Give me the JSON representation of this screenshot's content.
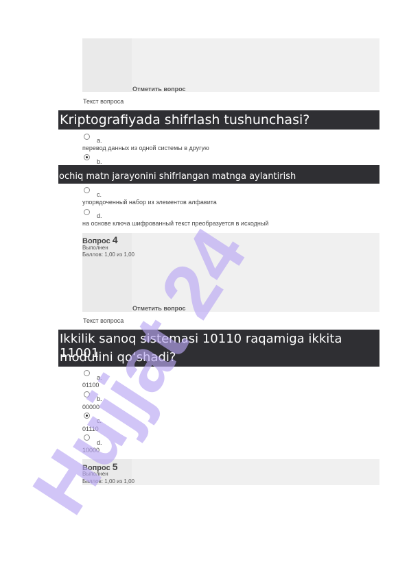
{
  "flag_label": "Отметить вопрос",
  "question_text_label": "Текст вопроса",
  "q3": {
    "text": "Kriptografiyada shifrlash tushunchasi?",
    "options": [
      {
        "letter": "a.",
        "text": "перевод данных из одной системы в другую",
        "checked": false
      },
      {
        "letter": "b.",
        "text": "ochiq matn jarayonini shifrlangan matnga aylantirish",
        "checked": true
      },
      {
        "letter": "c.",
        "text": "упорядоченный набор из элементов алфавита",
        "checked": false
      },
      {
        "letter": "d.",
        "text": "на основе ключа шифрованный текст преобразуется в исходный",
        "checked": false
      }
    ]
  },
  "q4": {
    "label": "Вопрос",
    "number": "4",
    "status": "Выполнен",
    "points": "Баллов: 1,00 из 1,00",
    "text_line1": "Ikkilik sanoq sistemasi 10110 raqamiga ikkita 11001",
    "text_line2": "modulini qo‘shadi?",
    "options": [
      {
        "letter": "a.",
        "text": "01100",
        "checked": false
      },
      {
        "letter": "b.",
        "text": "00000",
        "checked": false
      },
      {
        "letter": "c.",
        "text": "01110",
        "checked": true
      },
      {
        "letter": "d.",
        "text": "10000",
        "checked": false
      }
    ]
  },
  "q5": {
    "label": "Вопрос",
    "number": "5",
    "status": "Выполнен",
    "points": "Баллов: 1,00 из 1,00"
  },
  "watermark": {
    "text": "Hujjat 24",
    "color": "#b9a6f2"
  }
}
